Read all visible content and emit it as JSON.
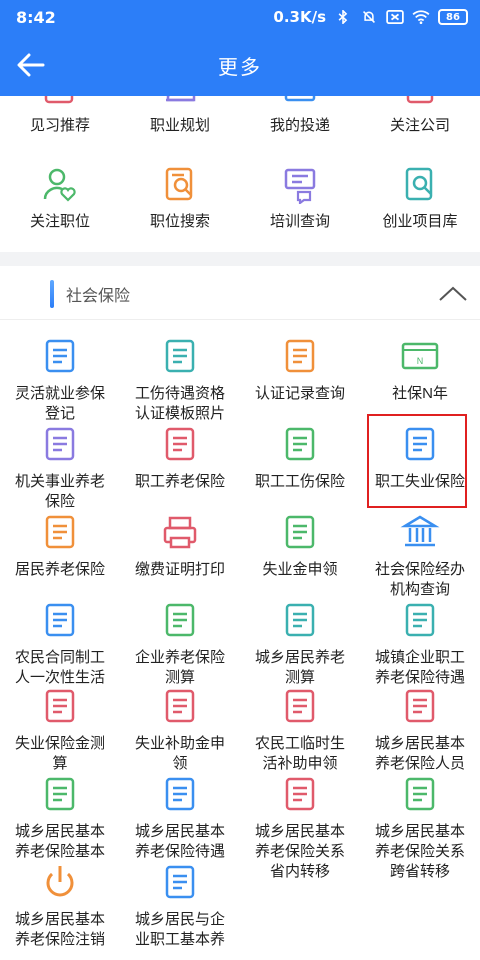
{
  "status": {
    "time": "8:42",
    "speed": "0.3K/s",
    "battery": "86"
  },
  "header": {
    "title": "更多"
  },
  "top_section": {
    "row1": [
      "见习推荐",
      "职业规划",
      "我的投递",
      "关注公司"
    ],
    "row2": [
      "关注职位",
      "职位搜索",
      "培训查询",
      "创业项目库"
    ]
  },
  "social_insurance": {
    "title": "社会保险",
    "items": [
      [
        "灵活就业参保",
        "登记"
      ],
      [
        "工伤待遇资格",
        "认证模板照片"
      ],
      [
        "认证记录查询"
      ],
      [
        "社保N年"
      ],
      [
        "机关事业养老",
        "保险"
      ],
      [
        "职工养老保险"
      ],
      [
        "职工工伤保险"
      ],
      [
        "职工失业保险"
      ],
      [
        "居民养老保险"
      ],
      [
        "缴费证明打印"
      ],
      [
        "失业金申领"
      ],
      [
        "社会保险经办",
        "机构查询"
      ],
      [
        "农民合同制工",
        "人一次性生活"
      ],
      [
        "企业养老保险",
        "测算"
      ],
      [
        "城乡居民养老",
        "测算"
      ],
      [
        "城镇企业职工",
        "养老保险待遇"
      ],
      [
        "失业保险金测",
        "算"
      ],
      [
        "失业补助金申",
        "领"
      ],
      [
        "农民工临时生",
        "活补助申领"
      ],
      [
        "城乡居民基本",
        "养老保险人员"
      ],
      [
        "城乡居民基本",
        "养老保险基本"
      ],
      [
        "城乡居民基本",
        "养老保险待遇"
      ],
      [
        "城乡居民基本",
        "养老保险关系",
        "省内转移"
      ],
      [
        "城乡居民基本",
        "养老保险关系",
        "跨省转移"
      ],
      [
        "城乡居民基本",
        "养老保险注销"
      ],
      [
        "城乡居民与企",
        "业职工基本养"
      ]
    ]
  },
  "icons": {
    "back": "back-arrow-icon",
    "signal": "signal-icon",
    "mute": "mute-icon",
    "wifi": "wifi-icon",
    "collapse": "chevron-up-icon"
  },
  "colors": {
    "primary": "#2c7ef8",
    "highlight": "#e02020"
  }
}
